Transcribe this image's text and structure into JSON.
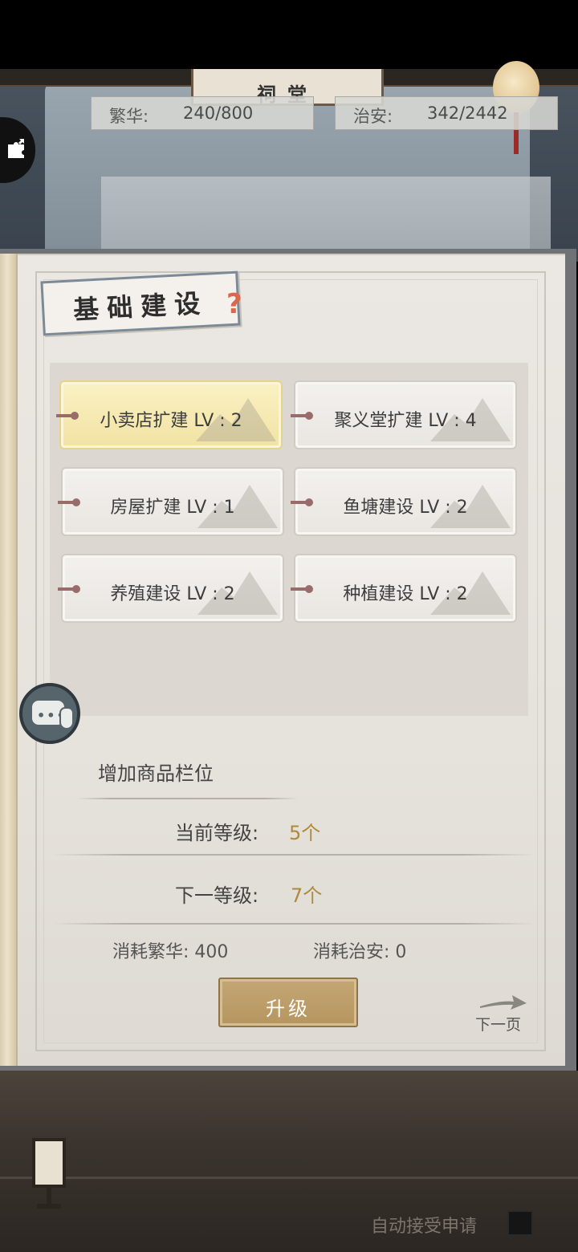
{
  "top_bar": {
    "plaque_text": "祠堂",
    "prosperity": {
      "label": "繁华:",
      "value": "240/800"
    },
    "security": {
      "label": "治安:",
      "value": "342/2442"
    }
  },
  "panel": {
    "title": "基础建设",
    "help_glyph": "?",
    "buildings": [
      {
        "label": "小卖店扩建 LV : 2",
        "selected": true
      },
      {
        "label": "聚义堂扩建 LV : 4",
        "selected": false
      },
      {
        "label": "房屋扩建 LV : 1",
        "selected": false
      },
      {
        "label": "鱼塘建设 LV : 2",
        "selected": false
      },
      {
        "label": "养殖建设 LV : 2",
        "selected": false
      },
      {
        "label": "种植建设 LV : 2",
        "selected": false
      }
    ],
    "detail": {
      "description": "增加商品栏位",
      "current_level_label": "当前等级:",
      "current_level_value": "5个",
      "next_level_label": "下一等级:",
      "next_level_value": "7个",
      "cost_prosperity": "消耗繁华: 400",
      "cost_security": "消耗治安: 0"
    },
    "upgrade_label": "升级",
    "next_page_label": "下一页"
  },
  "footer": {
    "auto_accept_label": "自动接受申请"
  },
  "colors": {
    "accent_gold": "#b08a3c",
    "button_gold": "#b6965f",
    "selected_card": "#f2e2a3"
  }
}
